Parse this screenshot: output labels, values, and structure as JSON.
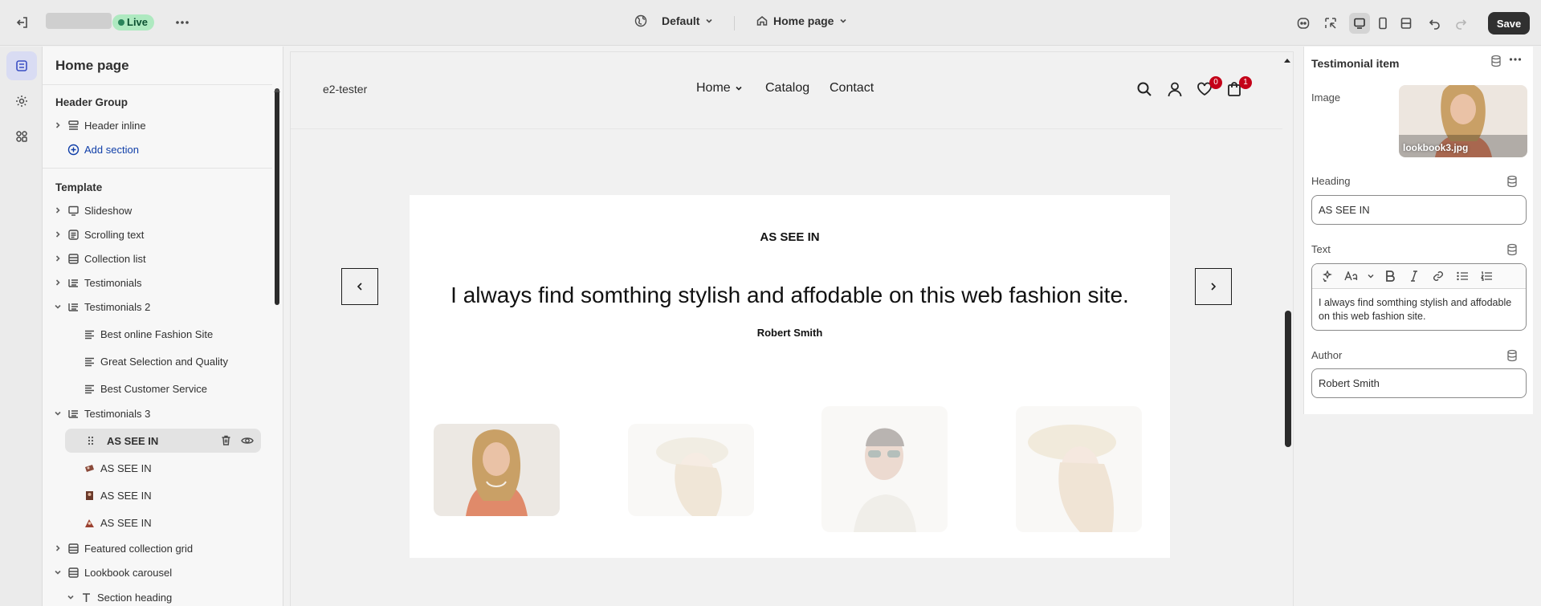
{
  "topbar": {
    "live_label": "Live",
    "theme_select": "Default",
    "page_select": "Home page",
    "save_label": "Save"
  },
  "sidebar": {
    "title": "Home page",
    "header_group": "Header Group",
    "header_inline": "Header inline",
    "add_section": "Add section",
    "template": "Template",
    "items": [
      {
        "label": "Slideshow"
      },
      {
        "label": "Scrolling text"
      },
      {
        "label": "Collection list"
      },
      {
        "label": "Testimonials"
      },
      {
        "label": "Testimonials 2"
      },
      {
        "label": "Best online Fashion Site"
      },
      {
        "label": "Great Selection and Quality"
      },
      {
        "label": "Best Customer Service"
      },
      {
        "label": "Testimonials 3"
      },
      {
        "label": "AS SEE IN"
      },
      {
        "label": "AS SEE IN"
      },
      {
        "label": "AS SEE IN"
      },
      {
        "label": "AS SEE IN"
      },
      {
        "label": "Featured collection grid"
      },
      {
        "label": "Lookbook carousel"
      },
      {
        "label": "Section heading"
      }
    ]
  },
  "preview": {
    "brand": "e2-tester",
    "nav": [
      "Home",
      "Catalog",
      "Contact"
    ],
    "wishlist_count": "0",
    "cart_count": "1",
    "heading": "AS SEE IN",
    "quote": "I always find somthing stylish and affodable on this web fashion site.",
    "author": "Robert Smith"
  },
  "panel": {
    "title": "Testimonial item",
    "image_label": "Image",
    "image_file": "lookbook3.jpg",
    "heading_label": "Heading",
    "heading_value": "AS SEE IN",
    "text_label": "Text",
    "text_value": "I always find somthing stylish and affodable on this web fashion site.",
    "author_label": "Author",
    "author_value": "Robert Smith"
  },
  "colors": {
    "accent": "#303030",
    "live_badge": "#aee9c0",
    "badge_red": "#c40018"
  }
}
